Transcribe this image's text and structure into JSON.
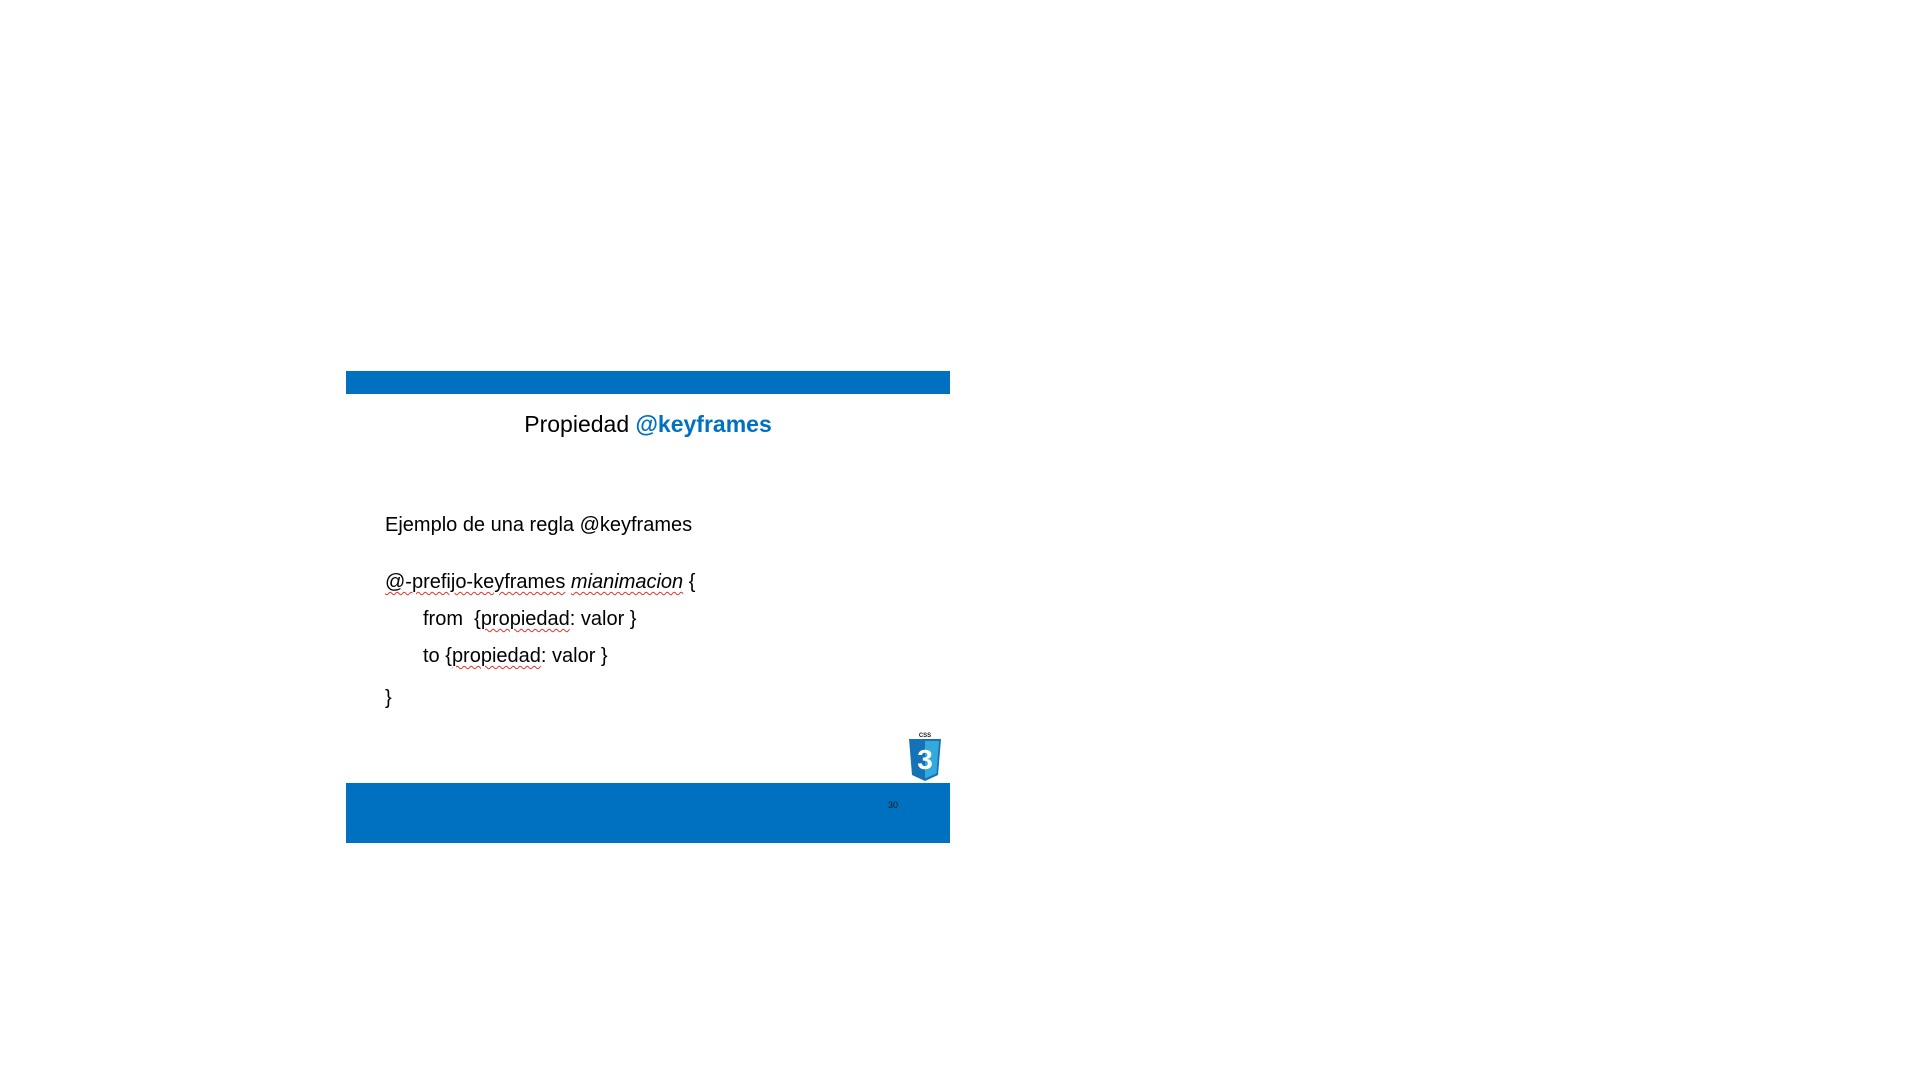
{
  "slide": {
    "title_prefix": "Propiedad",
    "title_accent": "@keyframes",
    "subtitle": "Ejemplo de una regla @keyframes",
    "code": {
      "line1_rule": "@-prefijo-keyframes",
      "line1_name": "mianimacion",
      "line1_brace": "{",
      "line2_keyword": "from",
      "line2_open": "{",
      "line2_prop": "propiedad",
      "line2_rest": ": valor }",
      "line3_keyword": "to",
      "line3_open": "{",
      "line3_prop": "propiedad",
      "line3_rest": ": valor }",
      "line4_close": "}"
    },
    "logo_label": "CSS",
    "logo_number": "3",
    "page_number": "30"
  },
  "colors": {
    "accent": "#0070c0",
    "spellcheck": "#e0332f"
  }
}
